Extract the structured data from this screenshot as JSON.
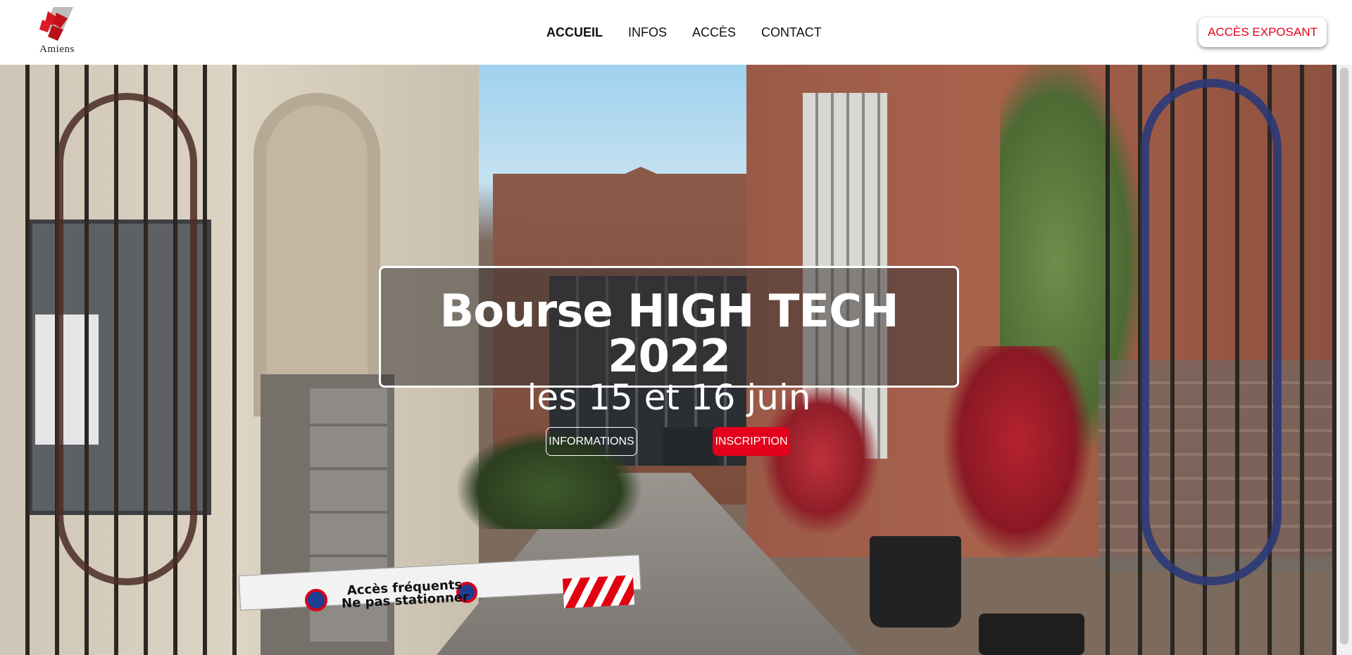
{
  "header": {
    "logo_text": "Amiens",
    "nav": [
      "ACCUEIL",
      "INFOS",
      "ACCÈS",
      "CONTACT"
    ],
    "active_nav": "ACCUEIL",
    "exposant_button": "ACCÈS EXPOSANT"
  },
  "hero": {
    "title": "Bourse HIGH TECH 2022",
    "subtitle": "les 15 et 16 juin",
    "buttons": {
      "informations": "INFORMATIONS",
      "inscription": "INSCRIPTION"
    },
    "barrier_sign": "Accès fréquents Ne pas stationner"
  },
  "colors": {
    "accent": "#e4001b",
    "text_dark": "#111111",
    "white": "#ffffff"
  }
}
